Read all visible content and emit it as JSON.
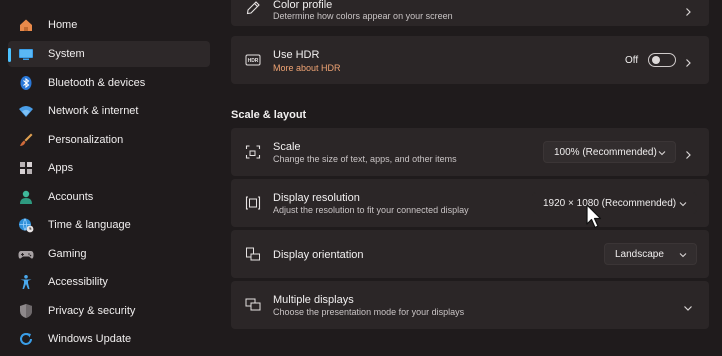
{
  "sidebar": {
    "items": [
      {
        "label": "Home",
        "icon": "home-icon",
        "active": false
      },
      {
        "label": "System",
        "icon": "system-icon",
        "active": true
      },
      {
        "label": "Bluetooth & devices",
        "icon": "bluetooth-icon",
        "active": false
      },
      {
        "label": "Network & internet",
        "icon": "wifi-icon",
        "active": false
      },
      {
        "label": "Personalization",
        "icon": "brush-icon",
        "active": false
      },
      {
        "label": "Apps",
        "icon": "apps-icon",
        "active": false
      },
      {
        "label": "Accounts",
        "icon": "accounts-icon",
        "active": false
      },
      {
        "label": "Time & language",
        "icon": "globe-clock-icon",
        "active": false
      },
      {
        "label": "Gaming",
        "icon": "gamepad-icon",
        "active": false
      },
      {
        "label": "Accessibility",
        "icon": "accessibility-icon",
        "active": false
      },
      {
        "label": "Privacy & security",
        "icon": "shield-icon",
        "active": false
      },
      {
        "label": "Windows Update",
        "icon": "update-icon",
        "active": false
      }
    ]
  },
  "color_profile": {
    "title": "Color profile",
    "subtitle": "Determine how colors appear on your screen"
  },
  "hdr": {
    "title": "Use HDR",
    "link": "More about HDR",
    "toggle_label": "Off",
    "toggle_on": false
  },
  "scale_layout": {
    "heading": "Scale & layout"
  },
  "scale": {
    "title": "Scale",
    "subtitle": "Change the size of text, apps, and other items",
    "value": "100% (Recommended)"
  },
  "resolution": {
    "title": "Display resolution",
    "subtitle": "Adjust the resolution to fit your connected display",
    "value": "1920 × 1080 (Recommended)"
  },
  "orientation": {
    "title": "Display orientation",
    "value": "Landscape"
  },
  "multiple": {
    "title": "Multiple displays",
    "subtitle": "Choose the presentation mode for your displays"
  },
  "colors": {
    "background": "#1f1b1c",
    "card": "#2b2627",
    "accent": "#4cc2ff",
    "link": "#f0a474"
  }
}
